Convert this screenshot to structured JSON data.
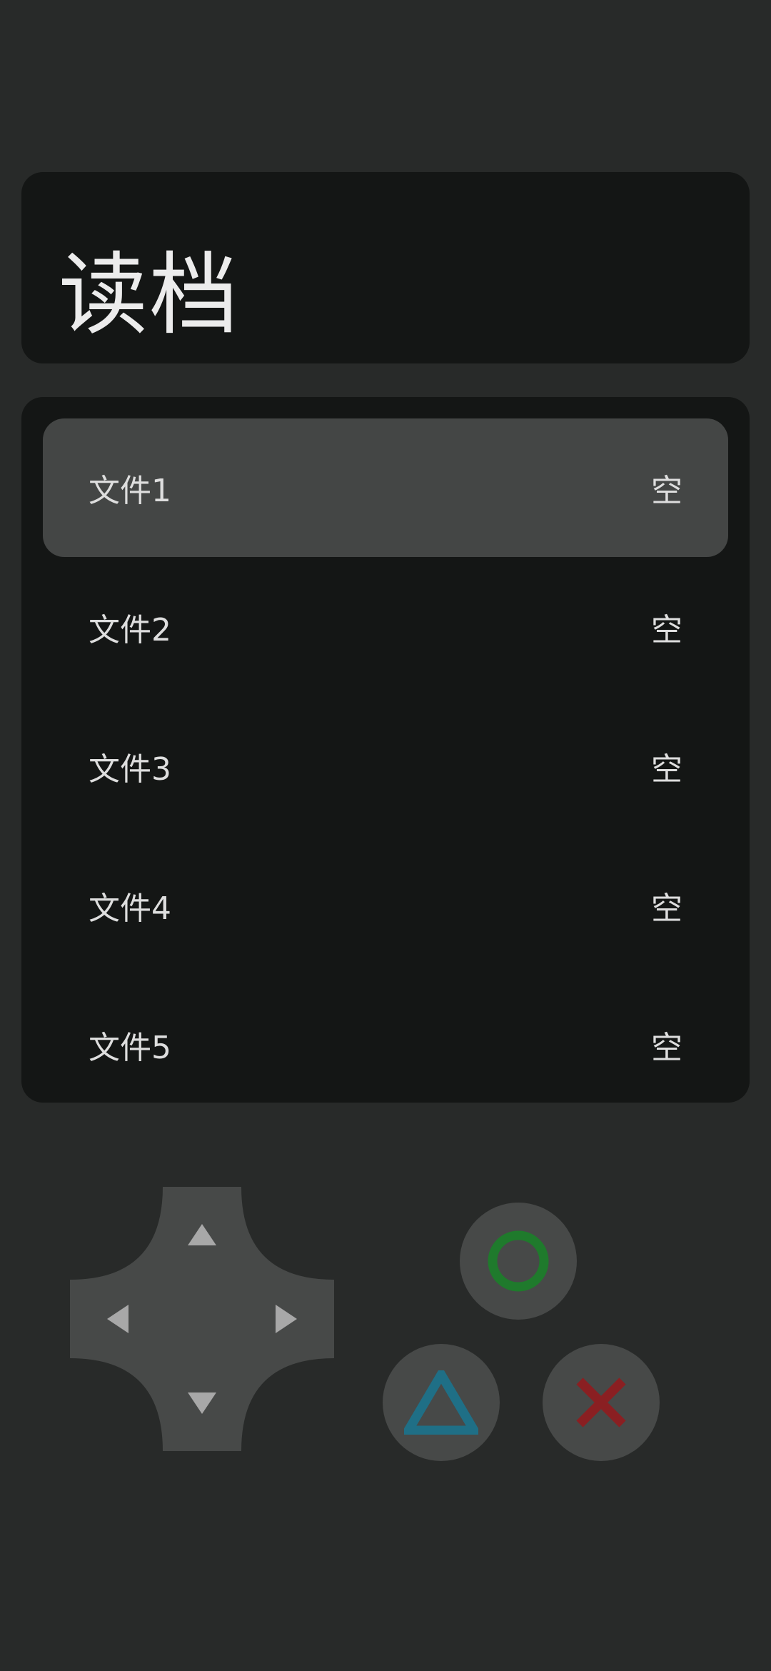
{
  "header": {
    "title": "读档"
  },
  "files": [
    {
      "name": "文件1",
      "status": "空",
      "selected": true
    },
    {
      "name": "文件2",
      "status": "空",
      "selected": false
    },
    {
      "name": "文件3",
      "status": "空",
      "selected": false
    },
    {
      "name": "文件4",
      "status": "空",
      "selected": false
    },
    {
      "name": "文件5",
      "status": "空",
      "selected": false
    }
  ],
  "controls": {
    "dpad_icons": [
      "up-arrow-icon",
      "down-arrow-icon",
      "left-arrow-icon",
      "right-arrow-icon"
    ],
    "buttons": [
      {
        "icon": "circle-icon",
        "color": "#1f7a2c"
      },
      {
        "icon": "triangle-icon",
        "color": "#1f6f86"
      },
      {
        "icon": "cross-icon",
        "color": "#8a1f22"
      }
    ]
  },
  "colors": {
    "background": "#282a29",
    "card": "#141615",
    "selected_row": "#444645",
    "control_button": "#474948"
  }
}
